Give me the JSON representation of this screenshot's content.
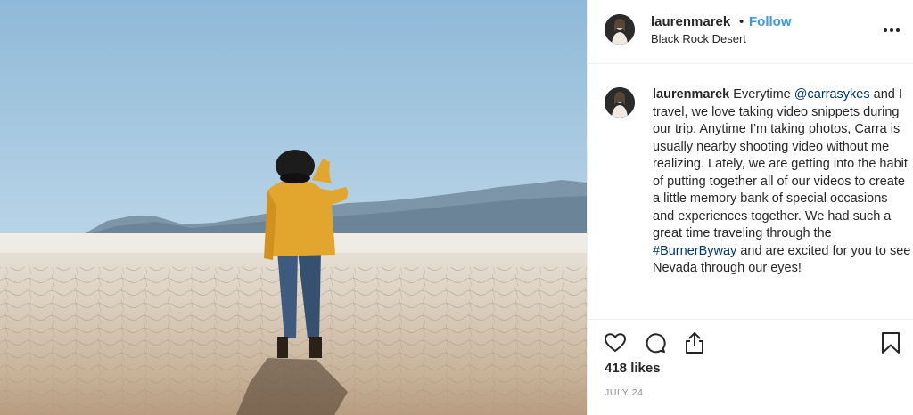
{
  "header": {
    "username": "laurenmarek",
    "separator": "•",
    "follow_label": "Follow",
    "location": "Black Rock Desert"
  },
  "caption": {
    "username": "laurenmarek",
    "text_1": "Everytime ",
    "mention": "@carrasykes",
    "text_2": " and I travel, we love taking video snippets during our trip. Anytime I’m taking photos, Carra is usually nearby shooting video without me realizing. Lately, we are getting into the habit of putting together all of our videos to create a little memory bank of special occasions and experiences together. We had such a great time traveling through the ",
    "hashtag": "#BurnerByway",
    "text_3": " and are excited for you to see Nevada through our eyes!"
  },
  "actions": {
    "icons": [
      "heart-icon",
      "comment-icon",
      "share-icon",
      "bookmark-icon"
    ]
  },
  "likes": "418 likes",
  "date": "JULY 24",
  "colors": {
    "link_blue": "#3897f0",
    "mention_blue": "#003569",
    "text": "#262626",
    "muted": "#8e8e8e",
    "divider": "#efefef"
  }
}
